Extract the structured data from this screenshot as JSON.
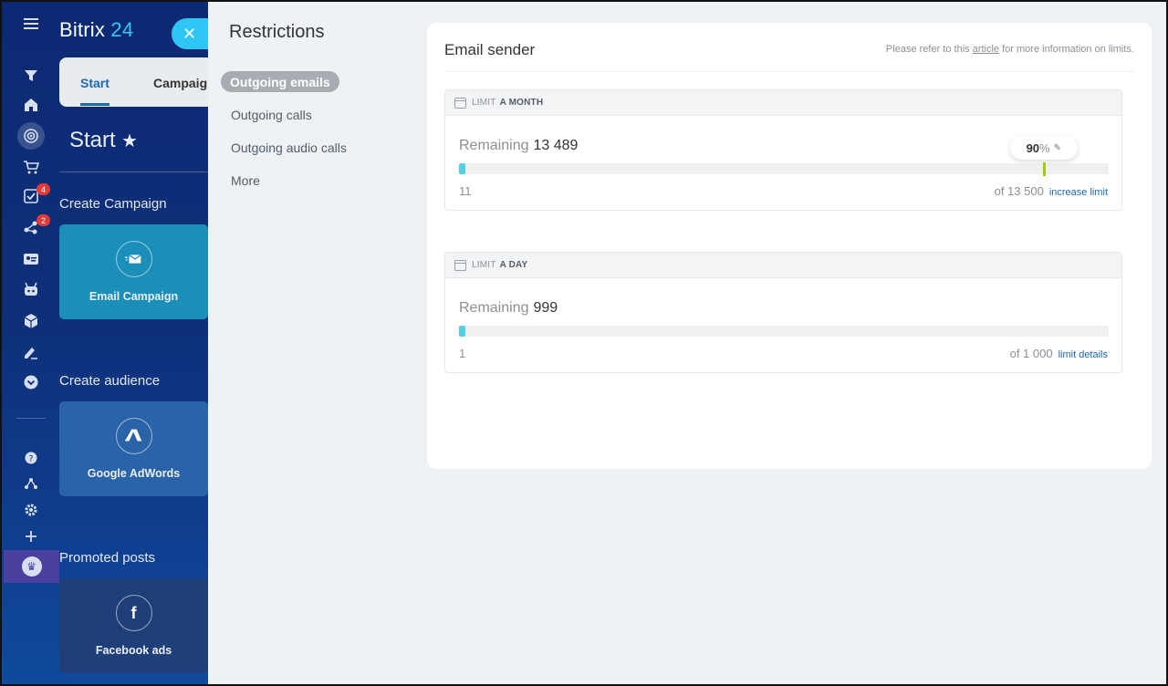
{
  "app": {
    "logo_main": "Bitrix",
    "logo_num": "24",
    "tabs": {
      "start": "Start",
      "campaign": "Campaig"
    },
    "page_title": "Start",
    "rail_badges": {
      "tasks": "4",
      "crm": "2"
    },
    "sections": [
      {
        "heading": "Create Campaign",
        "tile_label": "Email Campaign",
        "tile_icon": "envelope-icon",
        "tile_color": "#1b8fb8"
      },
      {
        "heading": "Create audience",
        "tile_label": "Google AdWords",
        "tile_icon": "adwords-icon",
        "tile_color": "#2a63a8"
      },
      {
        "heading": "Promoted posts",
        "tile_label": "Facebook ads",
        "tile_icon": "facebook-icon",
        "tile_glyph": "f",
        "tile_color": "#1f3f78"
      }
    ]
  },
  "panel": {
    "title": "Restrictions",
    "menu": [
      "Outgoing emails",
      "Outgoing calls",
      "Outgoing audio calls",
      "More"
    ],
    "active_menu": "Outgoing emails",
    "card": {
      "title": "Email sender",
      "note_prefix": "Please refer to this",
      "note_link": "article",
      "note_suffix": "for more information on limits."
    },
    "limits": [
      {
        "label_prefix": "LIMIT",
        "label_period": "A MONTH",
        "remaining_label": "Remaining",
        "remaining": "13 489",
        "used": "11",
        "total": "of 13 500",
        "link": "increase limit",
        "used_fraction": 0.0008,
        "threshold_value": "90",
        "threshold_unit": "%",
        "threshold_fraction": 0.9
      },
      {
        "label_prefix": "LIMIT",
        "label_period": "A DAY",
        "remaining_label": "Remaining",
        "remaining": "999",
        "used": "1",
        "total": "of 1 000",
        "link": "limit details",
        "used_fraction": 0.001
      }
    ]
  },
  "colors": {
    "accent": "#2fc6f6",
    "progress": "#55d0e0",
    "threshold": "#9dcf00",
    "link": "#2067b0"
  }
}
